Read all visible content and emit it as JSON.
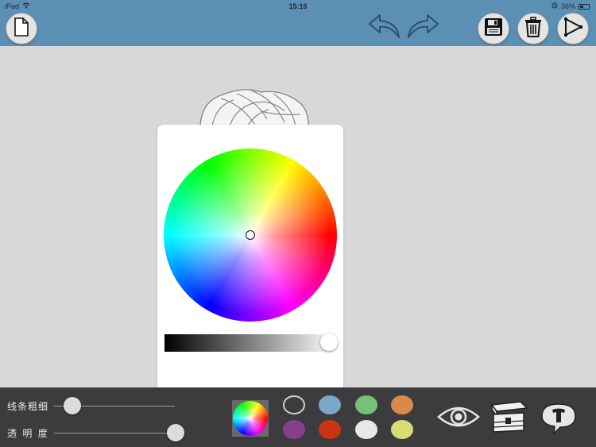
{
  "status_bar": {
    "device": "iPad",
    "time": "15:16",
    "battery": "36%"
  },
  "toolbar": {
    "new_icon": "document-icon",
    "undo_icon": "undo-arrow-icon",
    "redo_icon": "redo-arrow-icon",
    "save_icon": "floppy-disk-icon",
    "delete_icon": "trash-icon",
    "share_icon": "play-triangle-icon"
  },
  "color_picker": {
    "brightness_level": 1.0
  },
  "bottom_bar": {
    "line_width_label": "线条粗细",
    "line_width_value": 0.0,
    "opacity_label": "透 明 度",
    "opacity_value": 1.0,
    "swatches": [
      {
        "name": "none",
        "color": "transparent"
      },
      {
        "name": "blue",
        "color": "#7ba7c9"
      },
      {
        "name": "green",
        "color": "#77c07c"
      },
      {
        "name": "orange",
        "color": "#d78a4c"
      },
      {
        "name": "purple",
        "color": "#873f8b"
      },
      {
        "name": "red",
        "color": "#c93414"
      },
      {
        "name": "white",
        "color": "#e8e8e8"
      },
      {
        "name": "yellow",
        "color": "#d7dc77"
      }
    ],
    "tools": [
      "eye-icon",
      "treasure-chest-icon",
      "text-bubble-icon"
    ]
  }
}
